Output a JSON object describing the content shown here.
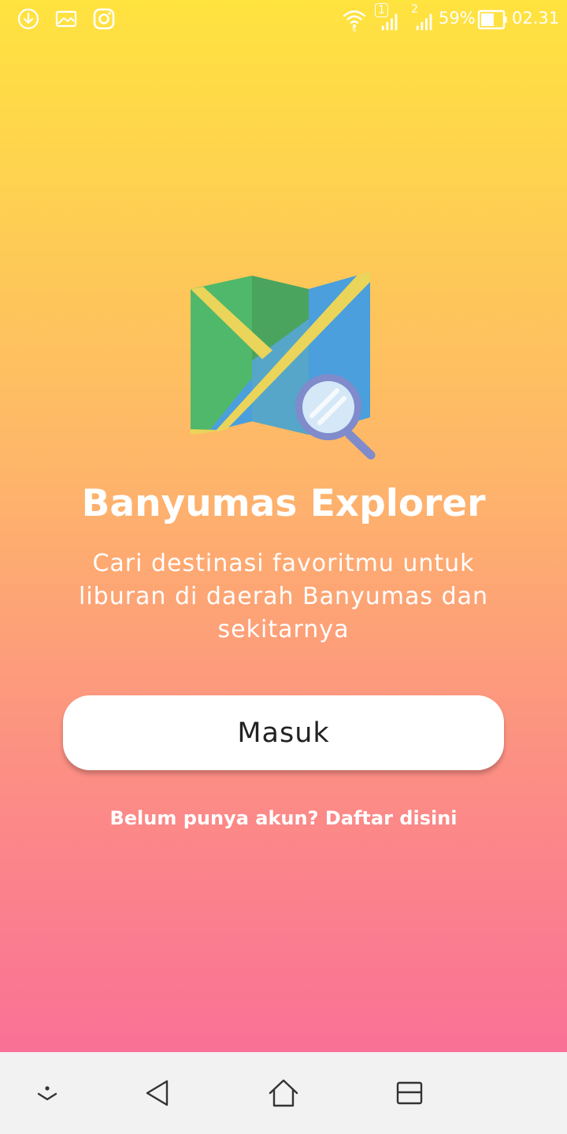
{
  "status_bar": {
    "battery_percent": "59%",
    "time": "02.31",
    "sim1_label": "1",
    "sim2_label": "2",
    "icons": [
      "download-icon",
      "image-icon",
      "instagram-icon",
      "wifi-icon",
      "signal-icon",
      "battery-icon"
    ]
  },
  "app": {
    "title": "Banyumas Explorer",
    "subtitle": "Cari destinasi favoritmu untuk liburan di daerah Banyumas dan sekitarnya",
    "login_button": "Masuk",
    "register_link": "Belum punya akun? Daftar disini",
    "logo_icon": "map-search-icon"
  },
  "nav_bar": {
    "icons": [
      "collapse-icon",
      "back-icon",
      "home-icon",
      "recents-icon"
    ]
  },
  "colors": {
    "gradient_top": "#FFE33F",
    "gradient_bottom": "#F97196",
    "button_bg": "#FFFFFF",
    "nav_bg": "#F2F2F2"
  }
}
